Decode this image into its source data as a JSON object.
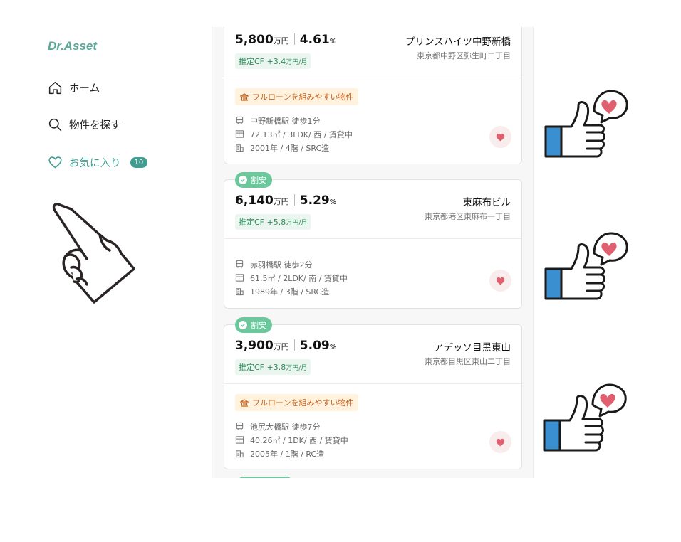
{
  "sidebar": {
    "logo": "Dr.Asset",
    "nav": [
      {
        "label": "ホーム",
        "icon": "home-icon"
      },
      {
        "label": "物件を探す",
        "icon": "search-icon"
      },
      {
        "label": "お気に入り",
        "icon": "heart-outline-icon",
        "badge": "10",
        "active": true
      }
    ]
  },
  "listings": [
    {
      "price": "5,800",
      "price_unit": "万円",
      "yield": "4.61",
      "yield_unit": "%",
      "cf_label": "推定CF",
      "cf_value": "+3.4",
      "cf_unit": "万円/月",
      "name": "プリンスハイツ中野新橋",
      "address": "東京都中野区弥生町二丁目",
      "loan_badge": "フルローンを組みやすい物件",
      "station": "中野新橋駅 徒歩1分",
      "layout": "72.13㎡ / 3LDK/ 西 / 賃貸中",
      "building": "2001年 / 4階 / SRC造"
    },
    {
      "tag": "割安",
      "price": "6,140",
      "price_unit": "万円",
      "yield": "5.29",
      "yield_unit": "%",
      "cf_label": "推定CF",
      "cf_value": "+5.8",
      "cf_unit": "万円/月",
      "name": "東麻布ビル",
      "address": "東京都港区東麻布一丁目",
      "station": "赤羽橋駅 徒歩2分",
      "layout": "61.5㎡ / 2LDK/ 南 / 賃貸中",
      "building": "1989年 / 3階 / SRC造"
    },
    {
      "tag": "割安",
      "price": "3,900",
      "price_unit": "万円",
      "yield": "5.09",
      "yield_unit": "%",
      "cf_label": "推定CF",
      "cf_value": "+3.8",
      "cf_unit": "万円/月",
      "name": "アデッソ目黒東山",
      "address": "東京都目黒区東山二丁目",
      "loan_badge": "フルローンを組みやすい物件",
      "station": "池尻大橋駅 徒歩7分",
      "layout": "40.26㎡ / 1DK/ 西 / 賃貸中",
      "building": "2005年 / 1階 / RC造"
    }
  ],
  "colors": {
    "accent": "#3f9f92",
    "tag_green": "#6cc79c",
    "heart": "#e0606f",
    "thumb_blue": "#3a8fd0"
  },
  "decorations": [
    "pointing-hand-illustration",
    "thumbs-up-heart-illustration"
  ]
}
